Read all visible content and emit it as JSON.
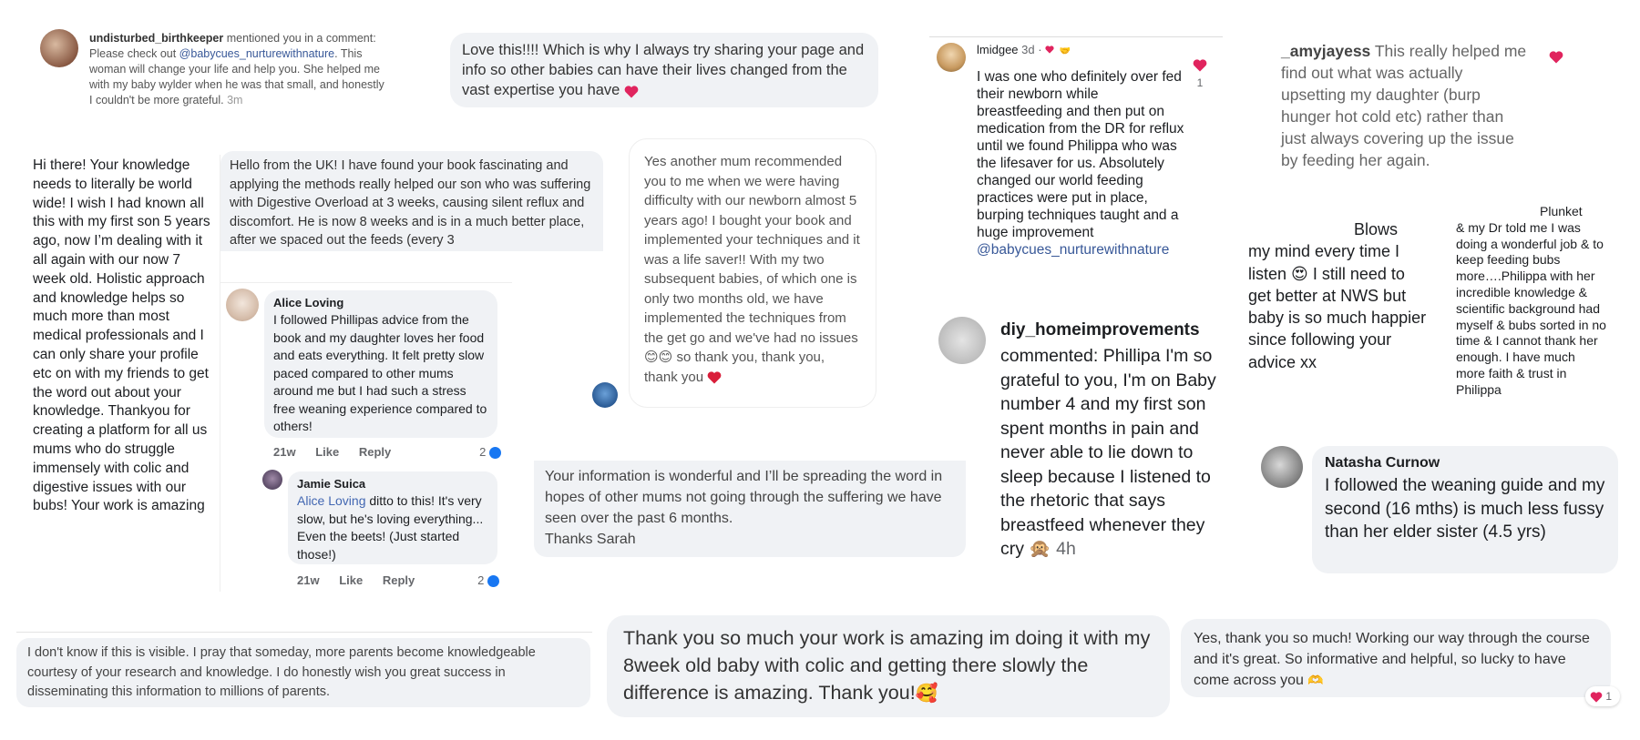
{
  "c1": {
    "username": "undisturbed_birthkeeper",
    "pre": " mentioned you in a comment: Please check out ",
    "mention": "@babycues_nurturewithnature",
    "post": ". This woman will change your life and help you. She helped me with my baby wylder when he was that small, and honestly I couldn't be more grateful.",
    "time": "3m"
  },
  "c2": {
    "text": "Love this!!!! Which is why I always try sharing your page and info so other babies can have their lives changed from the vast expertise you have"
  },
  "c3": {
    "username": "lmidgee",
    "time": "3d",
    "text": "I was one who definitely over fed their newborn while breastfeeding and then put on medication from the DR for reflux until we found Philippa who was the lifesaver for us. Absolutely changed our world feeding practices were put in place, burping techniques taught and a huge improvement",
    "mention": "@babycues_nurturewithnature",
    "like_count": "1"
  },
  "c4": {
    "username": "_amyjayess",
    "text": " This really helped me find out what was actually upsetting my daughter (burp hunger hot cold etc) rather than just always covering up the issue by feeding her again."
  },
  "c5": {
    "text": "Hi there! Your knowledge needs to literally be world wide! I wish I had known all this with my first son 5 years ago, now I’m dealing with it all again with our now 7 week old. Holistic approach and knowledge helps so much more than most medical professionals and I can only share your profile etc on with my friends to get the word out about your knowledge. Thankyou for creating a platform for all us mums who do struggle immensely with colic and digestive issues with our bubs! Your work is amazing"
  },
  "c6": {
    "text": "Hello from the UK! I have found your book fascinating and applying the methods really helped our son who was suffering with Digestive Overload at 3 weeks, causing silent reflux and discomfort. He is now 8 weeks and is in a much better place, after we spaced out the feeds (every 3"
  },
  "c7": {
    "name": "Alice Loving",
    "text": "I followed Phillipas advice from the book and my daughter loves her food and eats everything. It felt pretty slow paced compared to other mums around me but I had such a stress free weaning experience compared to others!",
    "time": "21w",
    "like": "Like",
    "reply": "Reply",
    "reactions": "2"
  },
  "c8": {
    "name": "Jamie Suica",
    "mention": "Alice Loving",
    "text": " ditto to this! It's very slow, but he's loving everything... Even the beets! (Just started those!)",
    "time": "21w",
    "like": "Like",
    "reply": "Reply",
    "reactions": "2"
  },
  "c9": {
    "text": "Yes another mum recommended you to me when we were having difficulty with our newborn almost 5 years ago! I bought your book and implemented your techniques and it was a life saver!! With my two subsequent babies, of which one is only two months old, we have implemented the techniques from the get go and we've had no issues",
    "tail": " so thank you, thank you, thank you"
  },
  "c10": {
    "text": "Your information is wonderful and I’ll be spreading the word in hopes of other mums not going through the suffering we have seen over the past 6 months.",
    "signoff": "Thanks Sarah"
  },
  "c11": {
    "username": "diy_homeimprovements",
    "text": "commented: Phillipa I'm so grateful to you, I'm on Baby number 4 and my first son spent months in pain and never able to lie down to sleep because I listened to the rhetoric that says breastfeed whenever they cry",
    "time": "4h"
  },
  "c12": {
    "line1": "Blows",
    "text": "my mind every time I listen",
    "tail": " I still need to get better at NWS but baby is so much happier since following your advice xx"
  },
  "c13": {
    "line1": "Plunket",
    "text": "& my Dr told me I was doing a wonderful job & to keep feeding bubs more….Philippa with her incredible knowledge & scientific background had myself & bubs sorted in no time & I cannot thank her enough. I have much more faith & trust in Philippa"
  },
  "c14": {
    "name": "Natasha Curnow",
    "text": "I followed the weaning guide and my second (16 mths) is much less fussy than her elder sister (4.5 yrs)"
  },
  "c15": {
    "text": "I don't know if this is visible. I pray that someday, more parents become knowledgeable courtesy of your research and knowledge. I do honestly wish you great success in disseminating this information to millions of parents."
  },
  "c16": {
    "text": "Thank you so much your work is amazing im doing it  with my 8week old baby with colic and getting there slowly the difference is amazing. Thank you!"
  },
  "c17": {
    "text": "Yes, thank you so much! Working our way through the course and it's great. So informative and helpful, so lucky to have come across you",
    "reactions": "1"
  },
  "colors": {
    "bubble": "#f0f2f5",
    "link": "#385898",
    "heart": "#e0245e",
    "like_blue": "#1877f2"
  },
  "icons": [
    "heart-icon",
    "like-reaction-icon",
    "smiling-emoji-icon",
    "monkey-emoji-icon",
    "heart-eyes-emoji-icon",
    "handshake-emoji-icon",
    "smiling-hearts-emoji-icon"
  ]
}
